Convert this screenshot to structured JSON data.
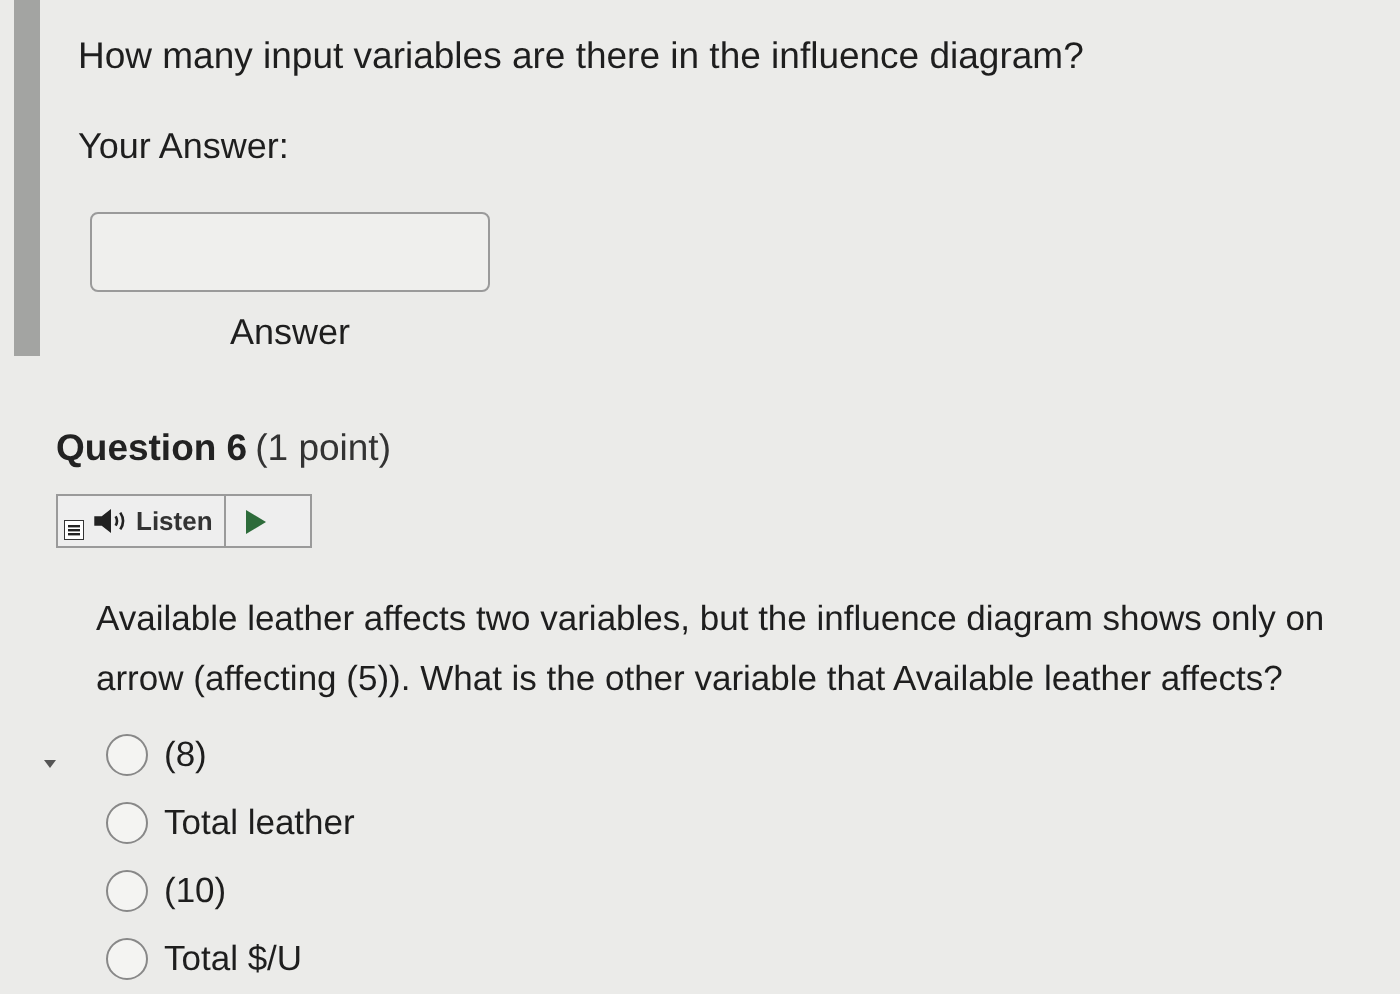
{
  "previous_question": {
    "prompt": "How many input variables are there in the influence diagram?",
    "answer_label": "Your Answer:",
    "field_caption": "Answer"
  },
  "question": {
    "title": "Question 6",
    "points": "(1 point)",
    "listen": {
      "label": "Listen"
    },
    "text_lines": [
      "Available leather affects two variables, but the influence diagram shows only on",
      "arrow (affecting (5)). What is the other variable that Available leather affects?"
    ],
    "options": [
      {
        "label": "(8)",
        "selected": false
      },
      {
        "label": "Total leather",
        "selected": false
      },
      {
        "label": "(10)",
        "selected": false
      },
      {
        "label": "Total $/U",
        "selected": false
      }
    ]
  }
}
